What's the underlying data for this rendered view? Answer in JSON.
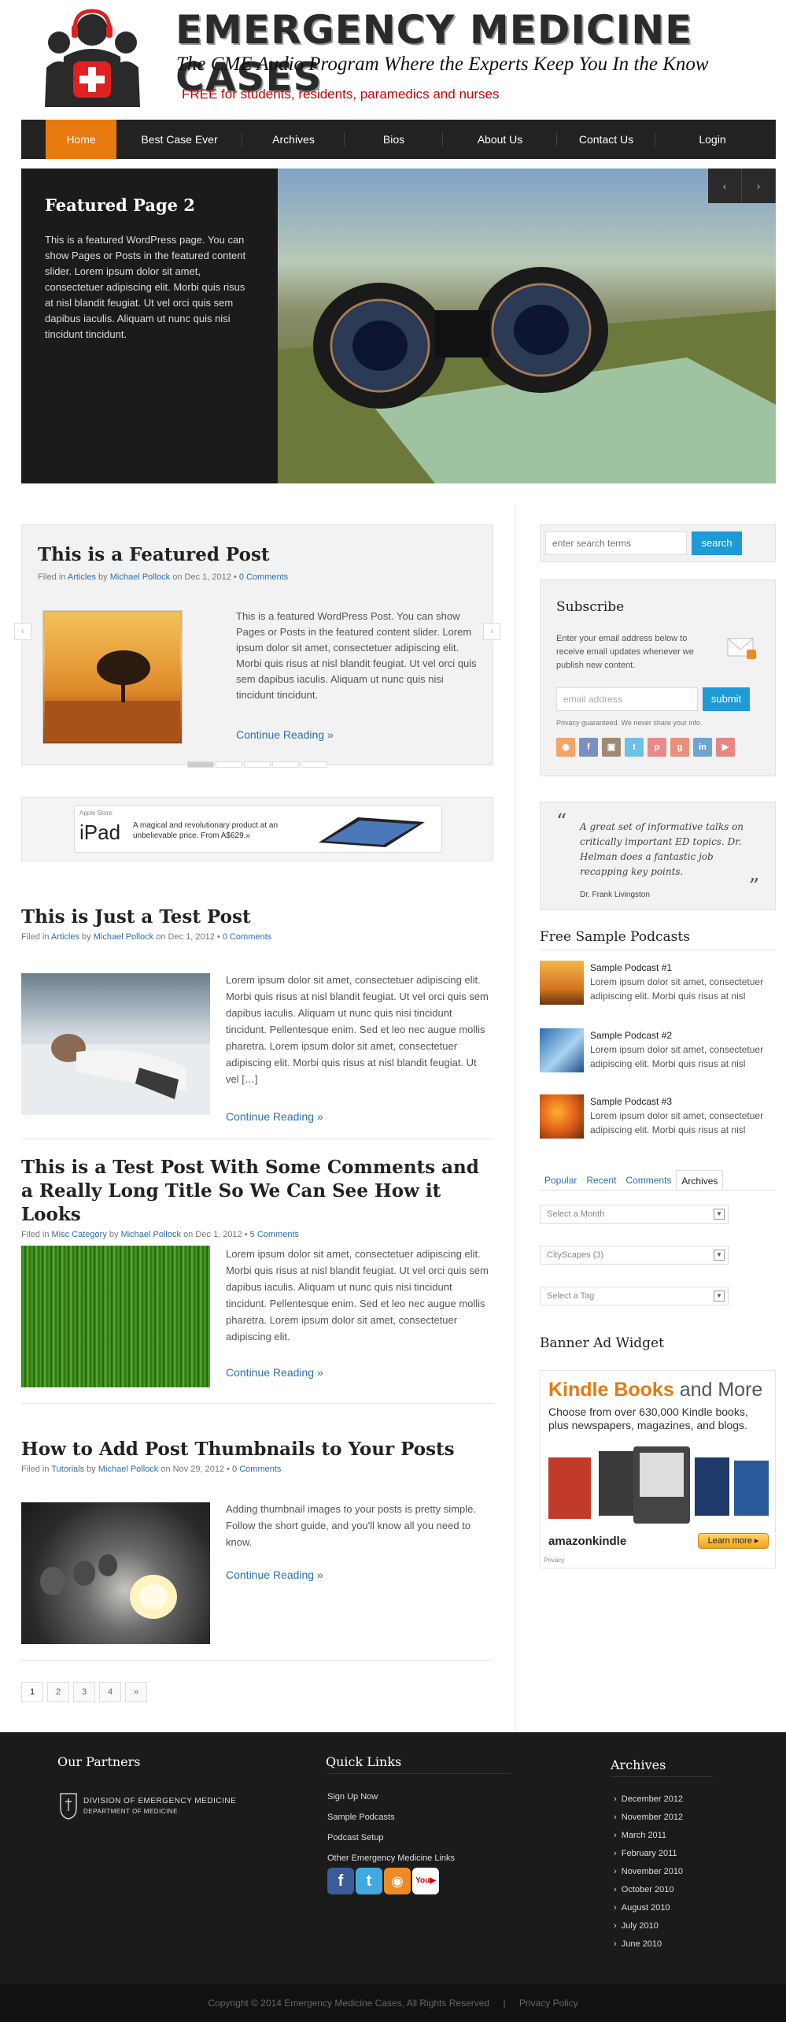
{
  "site": {
    "title": "EMERGENCY MEDICINE CASES",
    "tagline": "The CME Audio Program Where the Experts Keep You In the Know",
    "promo": "FREE for students, residents, paramedics and nurses",
    "accent": "#e8790f",
    "link_color": "#2a6fb0",
    "button_color": "#1e9bd7"
  },
  "nav": {
    "items": [
      "Home",
      "Best Case Ever",
      "Archives",
      "Bios",
      "About Us",
      "Contact Us",
      "Login"
    ],
    "active": "Home"
  },
  "slider": {
    "title": "Featured Page 2",
    "text": "This is a featured WordPress page. You can show Pages or Posts in the featured content slider. Lorem ipsum dolor sit amet, consectetuer adipiscing elit. Morbi quis risus at nisl blandit feugiat. Ut vel orci quis sem dapibus iaculis. Aliquam ut nunc quis nisi tincidunt tincidunt.",
    "prev": "‹",
    "next": "›"
  },
  "featured_post": {
    "title": "This is a Featured Post",
    "filed_in": "Filed in",
    "category": "Articles",
    "by": "by",
    "author": "Michael Pollock",
    "on": "on Dec 1, 2012 •",
    "comments": "0 Comments",
    "text": "This is a featured WordPress Post. You can show Pages or Posts in the featured content slider. Lorem ipsum dolor sit amet, consectetuer adipiscing elit. Morbi quis risus at nisl blandit feugiat. Ut vel orci quis sem dapibus iaculis. Aliquam ut nunc quis nisi tincidunt tincidunt.",
    "more": "Continue Reading »",
    "prev": "‹",
    "next": "›"
  },
  "ad": {
    "store": "Apple Store",
    "product": "iPad",
    "copy": "A magical and revolutionary product at an unbelievable price. From A$629.»"
  },
  "posts": [
    {
      "title": "This is Just a Test Post",
      "category": "Articles",
      "author": "Michael Pollock",
      "date": "on Dec 1, 2012 •",
      "comments": "0 Comments",
      "text": "Lorem ipsum dolor sit amet, consectetuer adipiscing elit. Morbi quis risus at nisl blandit feugiat. Ut vel orci quis sem dapibus iaculis. Aliquam ut nunc quis nisi tincidunt tincidunt. Pellentesque enim. Sed et leo nec augue mollis pharetra. Lorem ipsum dolor sit amet, consectetuer adipiscing elit. Morbi quis risus at nisl blandit feugiat. Ut vel […]",
      "more": "Continue Reading »"
    },
    {
      "title": "This is a Test Post With Some Comments and a Really Long Title So We Can See How it Looks",
      "category": "Misc Category",
      "author": "Michael Pollock",
      "date": "on Dec 1, 2012 •",
      "comments": "5 Comments",
      "text": "Lorem ipsum dolor sit amet, consectetuer adipiscing elit. Morbi quis risus at nisl blandit feugiat. Ut vel orci quis sem dapibus iaculis. Aliquam ut nunc quis nisi tincidunt tincidunt. Pellentesque enim. Sed et leo nec augue mollis pharetra. Lorem ipsum dolor sit amet, consectetuer adipiscing elit.",
      "more": "Continue Reading »"
    },
    {
      "title": "How to Add Post Thumbnails to Your Posts",
      "category": "Tutorials",
      "author": "Michael Pollock",
      "date": "on Nov 29, 2012 •",
      "comments": "0 Comments",
      "text": "Adding thumbnail images to your posts is pretty simple. Follow the short guide, and you'll know all you need to know.",
      "more": "Continue Reading »"
    }
  ],
  "pagination": [
    "1",
    "2",
    "3",
    "4",
    "»"
  ],
  "sidebar": {
    "search_placeholder": "enter search terms",
    "search_button": "search",
    "subscribe_title": "Subscribe",
    "subscribe_text": "Enter your email address below to receive email updates whenever we publish new content.",
    "email_placeholder": "email address",
    "submit": "submit",
    "privacy": "Privacy guaranteed. We never share your info.",
    "social": [
      {
        "icon": "rss-icon",
        "color": "#f0a56a",
        "glyph": "◉"
      },
      {
        "icon": "facebook-icon",
        "color": "#7b8fc0",
        "glyph": "f"
      },
      {
        "icon": "instagram-icon",
        "color": "#a08a76",
        "glyph": "▣"
      },
      {
        "icon": "twitter-icon",
        "color": "#6fc0e6",
        "glyph": "t"
      },
      {
        "icon": "pinterest-icon",
        "color": "#e88a8a",
        "glyph": "p"
      },
      {
        "icon": "google-plus-icon",
        "color": "#e8917a",
        "glyph": "g"
      },
      {
        "icon": "linkedin-icon",
        "color": "#6ea6cf",
        "glyph": "in"
      },
      {
        "icon": "youtube-icon",
        "color": "#e88585",
        "glyph": "▶"
      }
    ],
    "quote": "A great set of informative talks on critically important ED topics. Dr. Helman does a fantastic job recapping key points.",
    "quote_by": "Dr. Frank Livingston",
    "podcasts_title": "Free Sample Podcasts",
    "podcasts": [
      {
        "title": "Sample Podcast #1",
        "text": "Lorem ipsum dolor sit amet, consectetuer adipiscing elit. Morbi quis risus at nisl"
      },
      {
        "title": "Sample Podcast #2",
        "text": "Lorem ipsum dolor sit amet, consectetuer adipiscing elit. Morbi quis risus at nisl"
      },
      {
        "title": "Sample Podcast #3",
        "text": "Lorem ipsum dolor sit amet, consectetuer adipiscing elit. Morbi quis risus at nisl"
      }
    ],
    "tabs": [
      "Popular",
      "Recent",
      "Comments",
      "Archives"
    ],
    "active_tab": "Archives",
    "select_month": "Select a Month",
    "category_select": "CityScapes  (3)",
    "select_tag": "Select a Tag",
    "banner_title": "Banner Ad Widget",
    "kindle": {
      "headline_a": "Kindle Books",
      "headline_b": " and More",
      "sub": "Choose from over 630,000 Kindle books, plus newspapers, magazines, and blogs.",
      "brand": "amazonkindle",
      "learn": "Learn more ▸",
      "privacy": "Privacy"
    }
  },
  "footer": {
    "partners_title": "Our Partners",
    "partner_line1": "DIVISION OF EMERGENCY MEDICINE",
    "partner_line2": "DEPARTMENT OF MEDICINE",
    "links_title": "Quick Links",
    "links": [
      "Sign Up Now",
      "Sample Podcasts",
      "Podcast Setup",
      "Other Emergency Medicine Links"
    ],
    "archives_title": "Archives",
    "archives": [
      "December 2012",
      "November 2012",
      "March 2011",
      "February 2011",
      "November 2010",
      "October 2010",
      "August 2010",
      "July 2010",
      "June 2010"
    ],
    "copyright": "Copyright © 2014 Emergency Medicine Cases, All Rights Reserved",
    "sep": "|",
    "privacy": "Privacy Policy"
  }
}
